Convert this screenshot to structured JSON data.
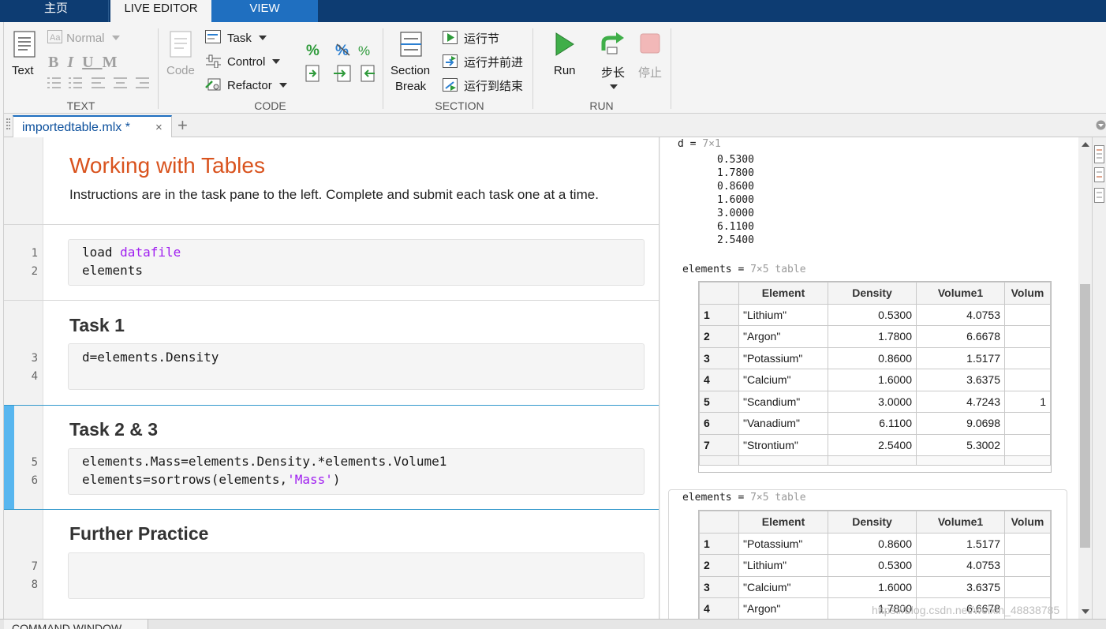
{
  "tabs": {
    "home": "主页",
    "live_editor": "LIVE EDITOR",
    "view": "VIEW"
  },
  "ribbon": {
    "text_group": {
      "text_btn": "Text",
      "style_dropdown": "Normal",
      "format_buttons": [
        "B",
        "I",
        "U",
        "M"
      ],
      "label": "TEXT"
    },
    "code_group": {
      "code_btn": "Code",
      "task": "Task",
      "control": "Control",
      "refactor": "Refactor",
      "label": "CODE"
    },
    "section_group": {
      "section_break_line1": "Section",
      "section_break_line2": "Break",
      "run_section": "运行节",
      "run_and_advance": "运行并前进",
      "run_to_end": "运行到结束",
      "label": "SECTION"
    },
    "run_group": {
      "run": "Run",
      "step": "步长",
      "stop": "停止",
      "label": "RUN"
    }
  },
  "document": {
    "tab_label": "importedtable.mlx *",
    "close": "×",
    "add": "+"
  },
  "editor": {
    "title": "Working with Tables",
    "instructions": "Instructions are in the task pane to the left. Complete and submit each task one at a time.",
    "sections": [
      {
        "heading": "",
        "lines": [
          {
            "num": "1",
            "plain": "load ",
            "kw": "datafile"
          },
          {
            "num": "2",
            "plain": "elements"
          }
        ]
      },
      {
        "heading": "Task 1",
        "lines": [
          {
            "num": "3",
            "plain": "d=elements.Density"
          },
          {
            "num": "4",
            "plain": ""
          }
        ]
      },
      {
        "heading": "Task 2 & 3",
        "lines": [
          {
            "num": "5",
            "plain": "elements.Mass=elements.Density.*elements.Volume1"
          },
          {
            "num": "6",
            "plain": "elements=sortrows(elements,",
            "str": "'Mass'",
            "tail": ")"
          }
        ]
      },
      {
        "heading": "Further Practice",
        "lines": [
          {
            "num": "7",
            "plain": ""
          },
          {
            "num": "8",
            "plain": ""
          }
        ]
      }
    ]
  },
  "output": {
    "d_name": "d = ",
    "d_size": "7×1",
    "d_values": [
      "0.5300",
      "1.7800",
      "0.8600",
      "1.6000",
      "3.0000",
      "6.1100",
      "2.5400"
    ],
    "table1": {
      "name": "elements = ",
      "size": "7×5 table",
      "columns": [
        "Element",
        "Density",
        "Volume1",
        "Volum"
      ],
      "rows": [
        [
          "1",
          "\"Lithium\"",
          "0.5300",
          "4.0753",
          ""
        ],
        [
          "2",
          "\"Argon\"",
          "1.7800",
          "6.6678",
          ""
        ],
        [
          "3",
          "\"Potassium\"",
          "0.8600",
          "1.5177",
          ""
        ],
        [
          "4",
          "\"Calcium\"",
          "1.6000",
          "3.6375",
          ""
        ],
        [
          "5",
          "\"Scandium\"",
          "3.0000",
          "4.7243",
          "1"
        ],
        [
          "6",
          "\"Vanadium\"",
          "6.1100",
          "9.0698",
          ""
        ],
        [
          "7",
          "\"Strontium\"",
          "2.5400",
          "5.3002",
          ""
        ]
      ]
    },
    "table2": {
      "name": "elements = ",
      "size": "7×5 table",
      "columns": [
        "Element",
        "Density",
        "Volume1",
        "Volum"
      ],
      "rows": [
        [
          "1",
          "\"Potassium\"",
          "0.8600",
          "1.5177",
          ""
        ],
        [
          "2",
          "\"Lithium\"",
          "0.5300",
          "4.0753",
          ""
        ],
        [
          "3",
          "\"Calcium\"",
          "1.6000",
          "3.6375",
          ""
        ],
        [
          "4",
          "\"Argon\"",
          "1.7800",
          "6.6678",
          ""
        ]
      ]
    }
  },
  "command_window": "COMMAND WINDOW",
  "watermark": "https://blog.csdn.net/weixin_48838785"
}
